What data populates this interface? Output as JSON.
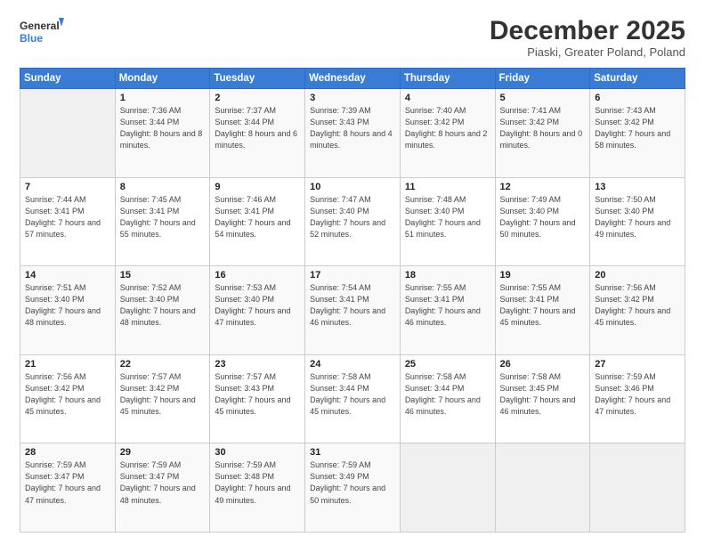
{
  "logo": {
    "line1": "General",
    "line2": "Blue"
  },
  "header": {
    "month": "December 2025",
    "location": "Piaski, Greater Poland, Poland"
  },
  "weekdays": [
    "Sunday",
    "Monday",
    "Tuesday",
    "Wednesday",
    "Thursday",
    "Friday",
    "Saturday"
  ],
  "weeks": [
    [
      {
        "day": "",
        "sunrise": "",
        "sunset": "",
        "daylight": ""
      },
      {
        "day": "1",
        "sunrise": "Sunrise: 7:36 AM",
        "sunset": "Sunset: 3:44 PM",
        "daylight": "Daylight: 8 hours and 8 minutes."
      },
      {
        "day": "2",
        "sunrise": "Sunrise: 7:37 AM",
        "sunset": "Sunset: 3:44 PM",
        "daylight": "Daylight: 8 hours and 6 minutes."
      },
      {
        "day": "3",
        "sunrise": "Sunrise: 7:39 AM",
        "sunset": "Sunset: 3:43 PM",
        "daylight": "Daylight: 8 hours and 4 minutes."
      },
      {
        "day": "4",
        "sunrise": "Sunrise: 7:40 AM",
        "sunset": "Sunset: 3:42 PM",
        "daylight": "Daylight: 8 hours and 2 minutes."
      },
      {
        "day": "5",
        "sunrise": "Sunrise: 7:41 AM",
        "sunset": "Sunset: 3:42 PM",
        "daylight": "Daylight: 8 hours and 0 minutes."
      },
      {
        "day": "6",
        "sunrise": "Sunrise: 7:43 AM",
        "sunset": "Sunset: 3:42 PM",
        "daylight": "Daylight: 7 hours and 58 minutes."
      }
    ],
    [
      {
        "day": "7",
        "sunrise": "Sunrise: 7:44 AM",
        "sunset": "Sunset: 3:41 PM",
        "daylight": "Daylight: 7 hours and 57 minutes."
      },
      {
        "day": "8",
        "sunrise": "Sunrise: 7:45 AM",
        "sunset": "Sunset: 3:41 PM",
        "daylight": "Daylight: 7 hours and 55 minutes."
      },
      {
        "day": "9",
        "sunrise": "Sunrise: 7:46 AM",
        "sunset": "Sunset: 3:41 PM",
        "daylight": "Daylight: 7 hours and 54 minutes."
      },
      {
        "day": "10",
        "sunrise": "Sunrise: 7:47 AM",
        "sunset": "Sunset: 3:40 PM",
        "daylight": "Daylight: 7 hours and 52 minutes."
      },
      {
        "day": "11",
        "sunrise": "Sunrise: 7:48 AM",
        "sunset": "Sunset: 3:40 PM",
        "daylight": "Daylight: 7 hours and 51 minutes."
      },
      {
        "day": "12",
        "sunrise": "Sunrise: 7:49 AM",
        "sunset": "Sunset: 3:40 PM",
        "daylight": "Daylight: 7 hours and 50 minutes."
      },
      {
        "day": "13",
        "sunrise": "Sunrise: 7:50 AM",
        "sunset": "Sunset: 3:40 PM",
        "daylight": "Daylight: 7 hours and 49 minutes."
      }
    ],
    [
      {
        "day": "14",
        "sunrise": "Sunrise: 7:51 AM",
        "sunset": "Sunset: 3:40 PM",
        "daylight": "Daylight: 7 hours and 48 minutes."
      },
      {
        "day": "15",
        "sunrise": "Sunrise: 7:52 AM",
        "sunset": "Sunset: 3:40 PM",
        "daylight": "Daylight: 7 hours and 48 minutes."
      },
      {
        "day": "16",
        "sunrise": "Sunrise: 7:53 AM",
        "sunset": "Sunset: 3:40 PM",
        "daylight": "Daylight: 7 hours and 47 minutes."
      },
      {
        "day": "17",
        "sunrise": "Sunrise: 7:54 AM",
        "sunset": "Sunset: 3:41 PM",
        "daylight": "Daylight: 7 hours and 46 minutes."
      },
      {
        "day": "18",
        "sunrise": "Sunrise: 7:55 AM",
        "sunset": "Sunset: 3:41 PM",
        "daylight": "Daylight: 7 hours and 46 minutes."
      },
      {
        "day": "19",
        "sunrise": "Sunrise: 7:55 AM",
        "sunset": "Sunset: 3:41 PM",
        "daylight": "Daylight: 7 hours and 45 minutes."
      },
      {
        "day": "20",
        "sunrise": "Sunrise: 7:56 AM",
        "sunset": "Sunset: 3:42 PM",
        "daylight": "Daylight: 7 hours and 45 minutes."
      }
    ],
    [
      {
        "day": "21",
        "sunrise": "Sunrise: 7:56 AM",
        "sunset": "Sunset: 3:42 PM",
        "daylight": "Daylight: 7 hours and 45 minutes."
      },
      {
        "day": "22",
        "sunrise": "Sunrise: 7:57 AM",
        "sunset": "Sunset: 3:42 PM",
        "daylight": "Daylight: 7 hours and 45 minutes."
      },
      {
        "day": "23",
        "sunrise": "Sunrise: 7:57 AM",
        "sunset": "Sunset: 3:43 PM",
        "daylight": "Daylight: 7 hours and 45 minutes."
      },
      {
        "day": "24",
        "sunrise": "Sunrise: 7:58 AM",
        "sunset": "Sunset: 3:44 PM",
        "daylight": "Daylight: 7 hours and 45 minutes."
      },
      {
        "day": "25",
        "sunrise": "Sunrise: 7:58 AM",
        "sunset": "Sunset: 3:44 PM",
        "daylight": "Daylight: 7 hours and 46 minutes."
      },
      {
        "day": "26",
        "sunrise": "Sunrise: 7:58 AM",
        "sunset": "Sunset: 3:45 PM",
        "daylight": "Daylight: 7 hours and 46 minutes."
      },
      {
        "day": "27",
        "sunrise": "Sunrise: 7:59 AM",
        "sunset": "Sunset: 3:46 PM",
        "daylight": "Daylight: 7 hours and 47 minutes."
      }
    ],
    [
      {
        "day": "28",
        "sunrise": "Sunrise: 7:59 AM",
        "sunset": "Sunset: 3:47 PM",
        "daylight": "Daylight: 7 hours and 47 minutes."
      },
      {
        "day": "29",
        "sunrise": "Sunrise: 7:59 AM",
        "sunset": "Sunset: 3:47 PM",
        "daylight": "Daylight: 7 hours and 48 minutes."
      },
      {
        "day": "30",
        "sunrise": "Sunrise: 7:59 AM",
        "sunset": "Sunset: 3:48 PM",
        "daylight": "Daylight: 7 hours and 49 minutes."
      },
      {
        "day": "31",
        "sunrise": "Sunrise: 7:59 AM",
        "sunset": "Sunset: 3:49 PM",
        "daylight": "Daylight: 7 hours and 50 minutes."
      },
      {
        "day": "",
        "sunrise": "",
        "sunset": "",
        "daylight": ""
      },
      {
        "day": "",
        "sunrise": "",
        "sunset": "",
        "daylight": ""
      },
      {
        "day": "",
        "sunrise": "",
        "sunset": "",
        "daylight": ""
      }
    ]
  ]
}
